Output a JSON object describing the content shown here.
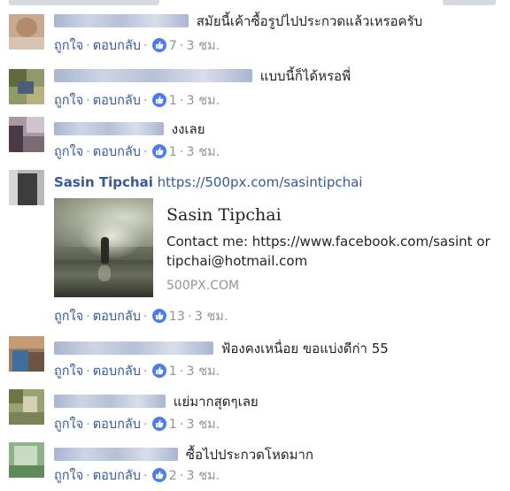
{
  "comments": [
    {
      "id": "c1",
      "author": "",
      "text": "สมัยนี้เค้าซื้อรูปไปประกวดแล้วเหรอครับ",
      "like_label": "ถูกใจ",
      "reply_label": "ตอบกลับ",
      "like_count": "7",
      "time": "3 ชม."
    },
    {
      "id": "c2",
      "author": "",
      "text": "แบบนี้ก็ได้หรอพี่",
      "like_label": "ถูกใจ",
      "reply_label": "ตอบกลับ",
      "like_count": "1",
      "time": "3 ชม."
    },
    {
      "id": "c3",
      "author": "",
      "text": "งงเลย",
      "like_label": "ถูกใจ",
      "reply_label": "ตอบกลับ",
      "like_count": "1",
      "time": "3 ชม."
    },
    {
      "id": "c4",
      "author": "Sasin Tipchai",
      "text": "https://500px.com/sasintipchai",
      "like_label": "ถูกใจ",
      "reply_label": "ตอบกลับ",
      "like_count": "13",
      "time": "3 ชม.",
      "preview": {
        "title": "Sasin Tipchai",
        "description": "Contact me: https://www.facebook.com/sasint or tipchai@hotmail.com",
        "domain": "500PX.COM"
      }
    },
    {
      "id": "c5",
      "author": "",
      "text": "ฟ้องคงเหนื่อย ขอแบ่งดีก่า 55",
      "like_label": "ถูกใจ",
      "reply_label": "ตอบกลับ",
      "like_count": "1",
      "time": "3 ชม."
    },
    {
      "id": "c6",
      "author": "",
      "text": "แย่มากสุดๆเลย",
      "like_label": "ถูกใจ",
      "reply_label": "ตอบกลับ",
      "like_count": "1",
      "time": "3 ชม."
    },
    {
      "id": "c7",
      "author": "",
      "text": "ซื้อไปประกวดโหดมาก",
      "like_label": "ถูกใจ",
      "reply_label": "ตอบกลับ",
      "like_count": "2",
      "time": "3 ชม."
    }
  ],
  "colors": {
    "link": "#365899",
    "text": "#1d2129",
    "meta": "#90949c",
    "like_badge": "#4a7cf3"
  },
  "icons": {
    "like": "thumbs-up-icon"
  }
}
